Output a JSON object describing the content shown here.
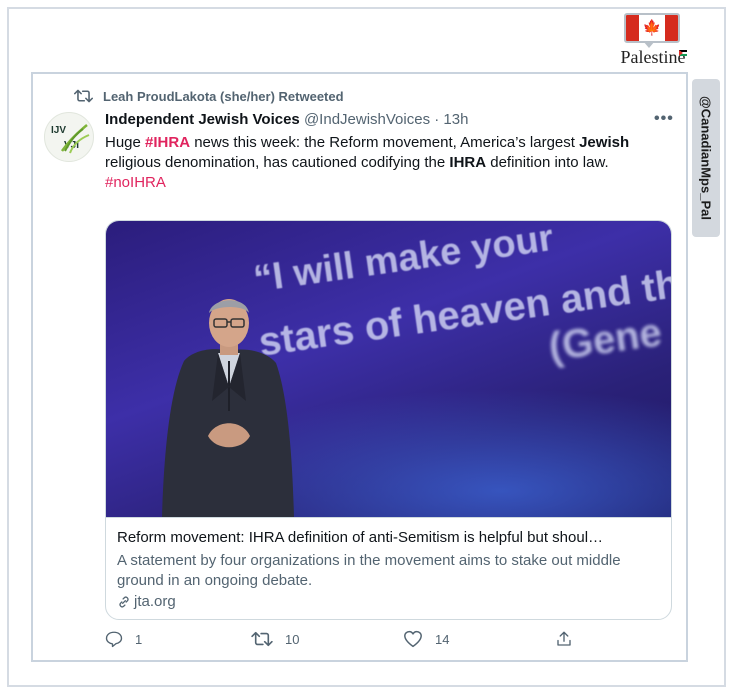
{
  "badge": {
    "label": "Palestine",
    "flag_color": "#d52b1e"
  },
  "side_tab": {
    "handle": "@CanadianMps_Pal"
  },
  "retweet": {
    "text": "Leah ProudLakota (she/her) Retweeted"
  },
  "tweet": {
    "avatar": {
      "line1": "IJV",
      "line2": "VJI"
    },
    "display_name": "Independent Jewish Voices",
    "handle": "@IndJewishVoices",
    "separator": "·",
    "time": "13h",
    "text": {
      "p1": "Huge ",
      "h1": "#IHRA",
      "p2": " news this week: the Reform movement, America’s largest ",
      "b1": "Jewish",
      "p3": " religious denomination, has cautioned codifying the ",
      "b2": "IHRA",
      "p4": " definition into law.",
      "h2": "#noIHRA"
    },
    "hashtag_color": "#e0245e"
  },
  "card": {
    "image": {
      "quote_line1": "“I will make your",
      "quote_line2": "stars of heaven and the",
      "quote_line3": "(Gene"
    },
    "title": "Reform movement: IHRA definition of anti-Semitism is helpful but shoul…",
    "description": "A statement by four organizations in the movement aims to stake out middle ground in an ongoing debate.",
    "domain": "jta.org"
  },
  "actions": {
    "reply_count": "1",
    "retweet_count": "10",
    "like_count": "14"
  }
}
